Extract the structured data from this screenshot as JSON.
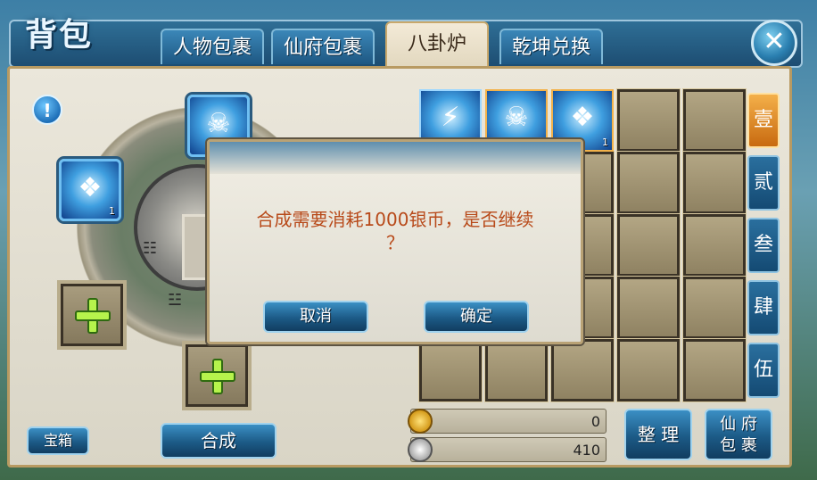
{
  "header": {
    "title": "背包",
    "tabs": [
      {
        "label": "人物包裹",
        "active": false
      },
      {
        "label": "仙府包裹",
        "active": false
      },
      {
        "label": "八卦炉",
        "active": true
      },
      {
        "label": "乾坤兑换",
        "active": false
      }
    ],
    "close_icon": "close-x-icon"
  },
  "left": {
    "info_icon": "exclamation-icon",
    "wheel_items": [
      {
        "icon": "skull-crystal-icon",
        "count": ""
      },
      {
        "icon": "shattered-stone-icon",
        "count": "1"
      }
    ],
    "trigram_top": "☰",
    "trigram_left": "☷",
    "trigram_bottom": "☳"
  },
  "inventory": {
    "items": [
      {
        "icon": "lightning-icon",
        "count": "1"
      },
      {
        "icon": "skull-crystal-icon",
        "count": "2"
      },
      {
        "icon": "shattered-stone-icon",
        "count": "1"
      }
    ],
    "page_tabs": [
      "壹",
      "贰",
      "叁",
      "肆",
      "伍"
    ],
    "active_page": 0
  },
  "currency": {
    "gold": "0",
    "silver": "410"
  },
  "buttons": {
    "treasure_box": "宝箱",
    "synthesize": "合成",
    "organize": "整 理",
    "fairy_bag_line1": "仙 府",
    "fairy_bag_line2": "包 裹"
  },
  "dialog": {
    "message_line1": "合成需要消耗1000银币，是否继续",
    "message_line2": "？",
    "cancel": "取消",
    "confirm": "确定"
  },
  "colors": {
    "accent_blue": "#1c5a86",
    "active_page_orange": "#e08a20",
    "dialog_text": "#b84a1a"
  }
}
